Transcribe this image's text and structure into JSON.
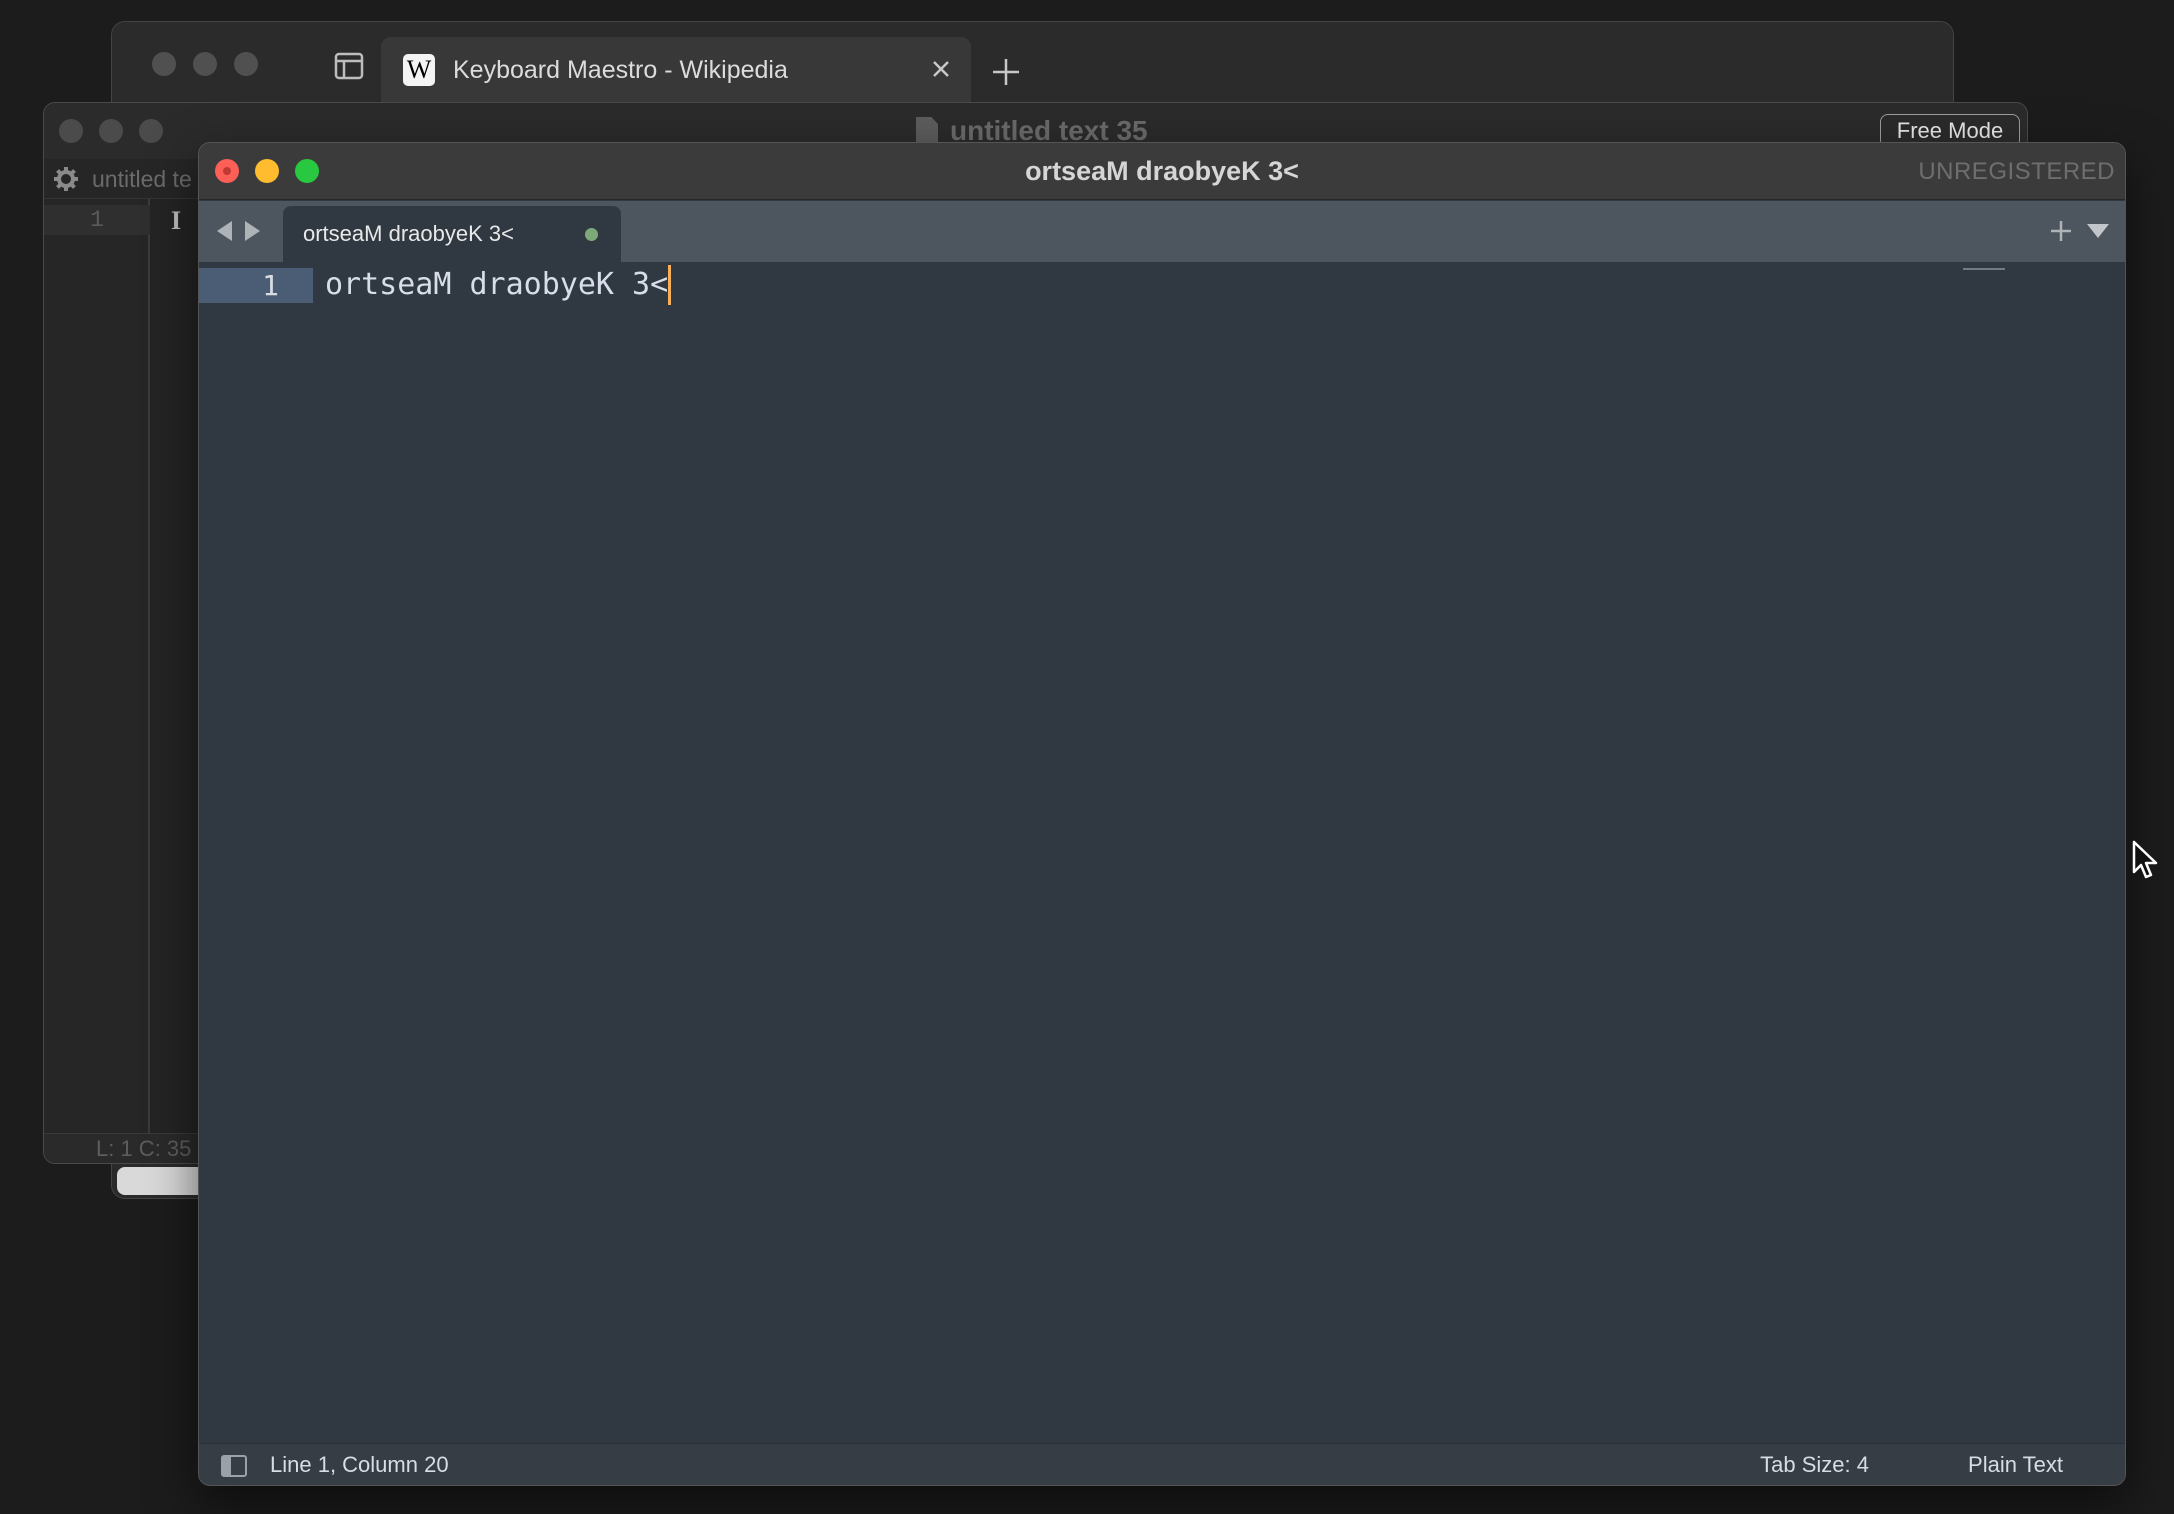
{
  "browser": {
    "tab_title": "Keyboard Maestro - Wikipedia",
    "favicon_letter": "W",
    "icons": [
      "sidebar-icon",
      "wikipedia-favicon",
      "close-icon",
      "plus-icon"
    ]
  },
  "back_editor": {
    "title": "untitled text 35",
    "mode_button": "Free Mode",
    "tab_label": "untitled te",
    "line_number": "1",
    "cursor_glyph": "I",
    "status": "L: 1 C: 35",
    "icons": [
      "document-icon",
      "gear-icon"
    ]
  },
  "editor": {
    "window_title": "ortseaM draobyeK 3<",
    "license": "UNREGISTERED",
    "tab_label": "ortseaM draobyeK 3<",
    "lines": [
      {
        "number": "1",
        "text": "ortseaM draobyeK 3<"
      }
    ],
    "status": {
      "position": "Line 1, Column 20",
      "tab_size": "Tab Size: 4",
      "syntax": "Plain Text"
    },
    "colors": {
      "background": "#303841",
      "tab_bar": "#4d555e",
      "caret": "#f9ae58",
      "line_highlight": "#4b5d75",
      "modified_dot": "#7ea87a"
    },
    "icons": [
      "nav-back-icon",
      "nav-forward-icon",
      "plus-icon",
      "chevron-down-icon",
      "sidebar-toggle-icon"
    ]
  }
}
